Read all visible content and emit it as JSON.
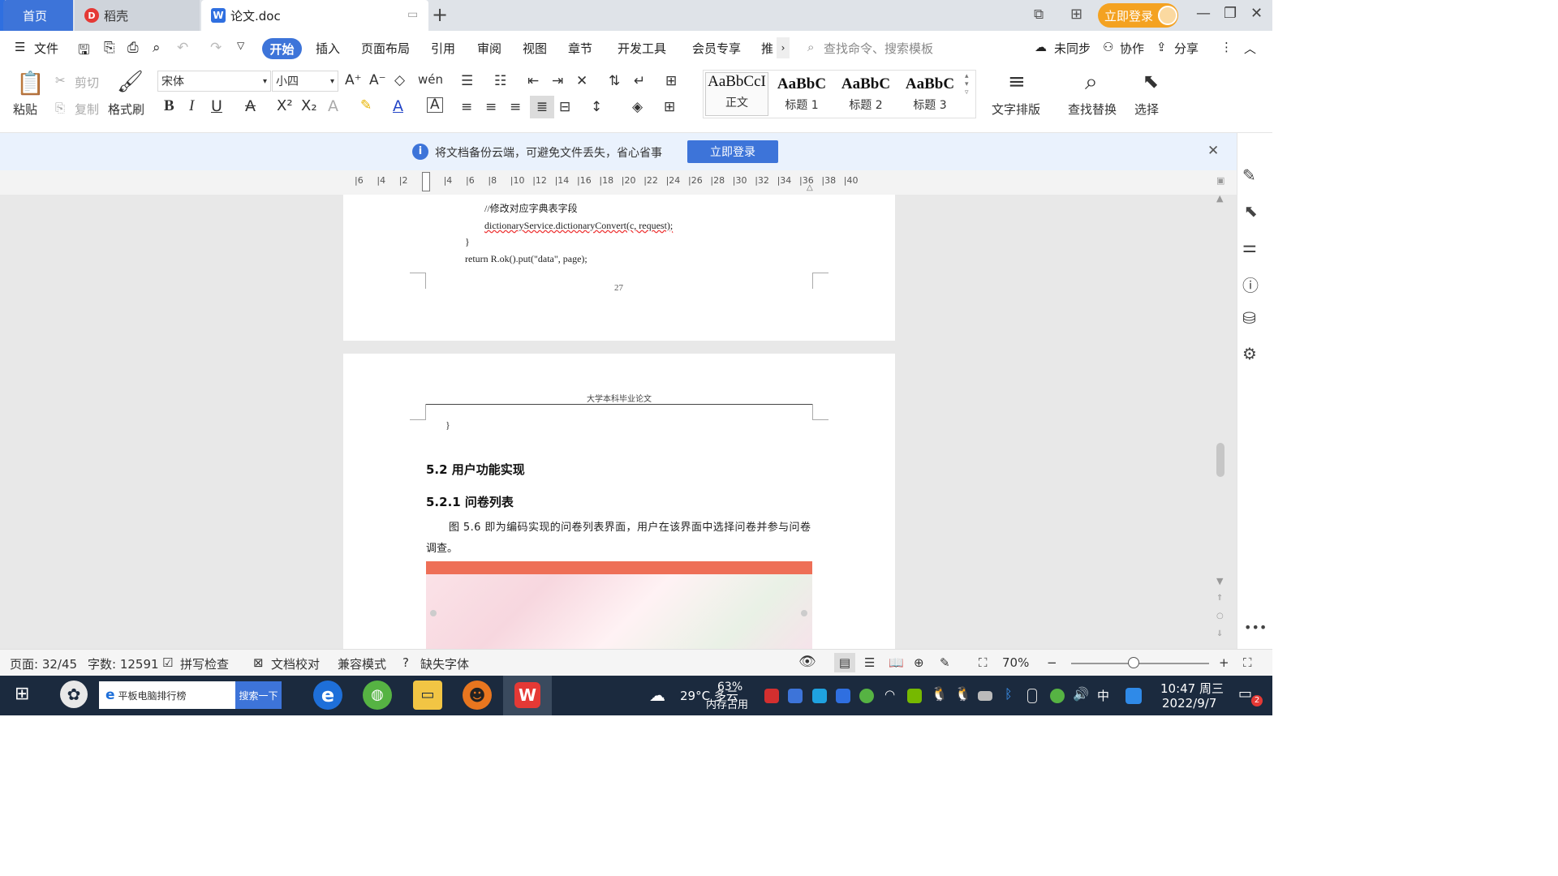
{
  "tabs": {
    "home": "首页",
    "daoke": "稻壳",
    "doc": "论文.doc"
  },
  "title_bar": {
    "login": "立即登录"
  },
  "menu": {
    "file": "文件",
    "items": [
      "开始",
      "插入",
      "页面布局",
      "引用",
      "审阅",
      "视图",
      "章节",
      "开发工具",
      "会员专享",
      "推"
    ],
    "search_placeholder": "查找命令、搜索模板",
    "unsynced": "未同步",
    "collaborate": "协作",
    "share": "分享"
  },
  "ribbon": {
    "paste": "粘贴",
    "cut": "剪切",
    "copy": "复制",
    "format_painter": "格式刷",
    "font_name": "宋体",
    "font_size": "小四",
    "styles": [
      {
        "sample": "AaBbCcI",
        "label": "正文"
      },
      {
        "sample": "AaBbC",
        "label": "标题 1"
      },
      {
        "sample": "AaBbC",
        "label": "标题 2"
      },
      {
        "sample": "AaBbC",
        "label": "标题 3"
      }
    ],
    "text_layout": "文字排版",
    "find_replace": "查找替换",
    "select": "选择"
  },
  "notice": {
    "message": "将文档备份云端，可避免文件丢失，省心省事",
    "button": "立即登录"
  },
  "ruler": [
    "6",
    "4",
    "2",
    "2",
    "4",
    "6",
    "8",
    "10",
    "12",
    "14",
    "16",
    "18",
    "20",
    "22",
    "24",
    "26",
    "28",
    "30",
    "32",
    "34",
    "36",
    "38",
    "40"
  ],
  "document": {
    "code_lines": [
      "//修改对应字典表字段",
      "dictionaryService.dictionaryConvert(c, request);",
      "}",
      "return R.ok().put(\"data\", page);"
    ],
    "page_number": "27",
    "header": "大学本科毕业论文",
    "brace": "}",
    "h2": "5.2  用户功能实现",
    "h3": "5.2.1  问卷列表",
    "para_line1": "图 5.6 即为编码实现的问卷列表界面，用户在该界面中选择问卷并参与问卷",
    "para_line2": "调查。"
  },
  "status": {
    "page": "页面: 32/45",
    "words": "字数: 12591",
    "spell": "拼写检查",
    "proof": "文档校对",
    "compat": "兼容模式",
    "missing_font": "缺失字体",
    "zoom": "70%",
    "zoom_level": 0.45
  },
  "taskbar": {
    "search_text": "平板电脑排行榜",
    "search_button": "搜索一下",
    "weather": "29°C 多云",
    "mem_percent": "63%",
    "mem_label": "内存占用",
    "ime": "中",
    "time": "10:47 周三",
    "date": "2022/9/7",
    "notif_count": "2"
  },
  "colors": {
    "accent": "#3d74d9",
    "login_orange": "#f4a221",
    "taskbar": "#1b2a3e"
  }
}
